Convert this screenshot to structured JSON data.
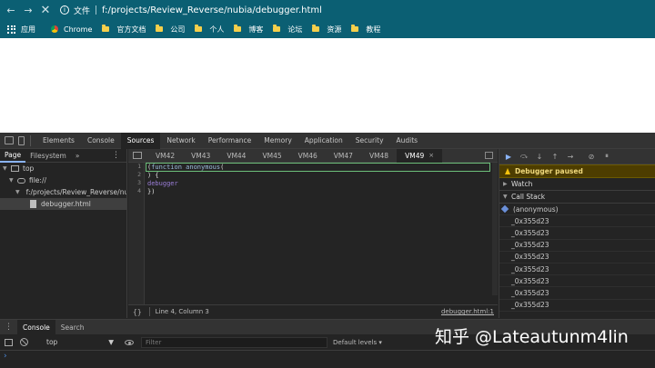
{
  "browser": {
    "url_label": "文件",
    "url": "f:/projects/Review_Reverse/nubia/debugger.html",
    "bookmarks": [
      "应用",
      "Chrome",
      "官方文档",
      "公司",
      "个人",
      "博客",
      "论坛",
      "资源",
      "教程"
    ]
  },
  "devtools": {
    "main_tabs": [
      "Elements",
      "Console",
      "Sources",
      "Network",
      "Performance",
      "Memory",
      "Application",
      "Security",
      "Audits"
    ],
    "active_main_tab": "Sources",
    "navigator": {
      "tabs": [
        "Page",
        "Filesystem"
      ],
      "more": "»",
      "tree": [
        "top",
        "file://",
        "f:/projects/Review_Reverse/nubia",
        "debugger.html"
      ]
    },
    "editor": {
      "tabs": [
        "VM42",
        "VM43",
        "VM44",
        "VM45",
        "VM46",
        "VM47",
        "VM48",
        "VM49"
      ],
      "active_tab": "VM49",
      "close_glyph": "×",
      "line_numbers": [
        "1",
        "2",
        "3",
        "4"
      ],
      "code": {
        "l1_a": "(",
        "l1_kw": "function",
        "l1_fn": " anonymous",
        "l1_b": "(",
        "l2": ") {",
        "l3": "debugger",
        "l4": "})"
      },
      "status_braces": "{}",
      "status": "Line 4, Column 3",
      "status_link": "debugger.html:1"
    },
    "debugger": {
      "paused": "Debugger paused",
      "watch": "Watch",
      "call_stack": "Call Stack",
      "frames": [
        "(anonymous)",
        "_0x355d23",
        "_0x355d23",
        "_0x355d23",
        "_0x355d23",
        "_0x355d23",
        "_0x355d23",
        "_0x355d23",
        "_0x355d23"
      ]
    },
    "drawer": {
      "tabs": [
        "Console",
        "Search"
      ],
      "context": "top",
      "filter_placeholder": "Filter",
      "levels": "Default levels ▾",
      "prompt": "›"
    }
  },
  "watermark": "知乎 @Lateautunm4lin"
}
